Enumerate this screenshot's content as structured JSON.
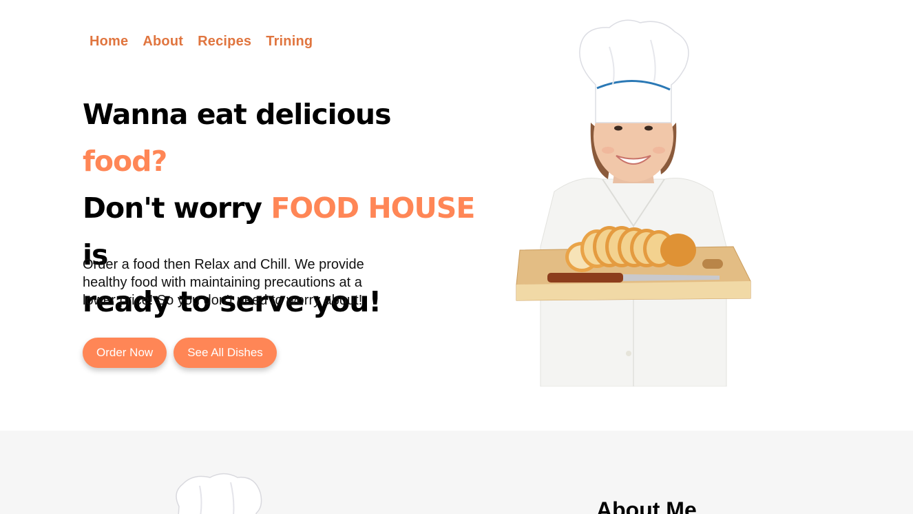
{
  "nav": {
    "items": [
      {
        "label": "Home"
      },
      {
        "label": "About"
      },
      {
        "label": "Recipes"
      },
      {
        "label": "Trining"
      }
    ]
  },
  "hero": {
    "line1_text": "Wanna eat delicious ",
    "line1_accent": "food?",
    "line2_text": "Don't worry ",
    "line2_accent": "FOOD HOUSE",
    "line2_tail": " is",
    "line3_text": "ready to serve you!",
    "description": "Order a food then Relax and Chill. We provide healthy food with maintaining precautions at a lower price! So you don't need to worry about!",
    "buttons": {
      "order": "Order Now",
      "see_all": "See All Dishes"
    }
  },
  "about": {
    "title": "About Me"
  },
  "colors": {
    "accent": "#ff8656",
    "nav_link": "#e0753f",
    "section_bg": "#f6f6f6"
  },
  "icons": {
    "hero_image": "chef-holding-bread-image",
    "about_image": "chef-hat-image"
  }
}
